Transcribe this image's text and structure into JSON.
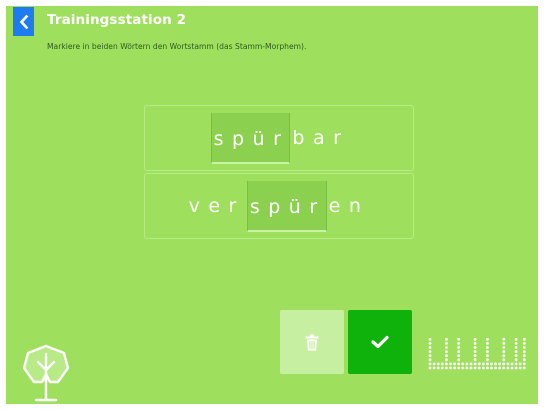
{
  "header": {
    "title": "Trainingsstation 2",
    "back_icon": "chevron-left-icon"
  },
  "instruction": "Markiere in beiden Wörtern den Wortstamm (das Stamm-Morphem).",
  "words": [
    {
      "prefix": "",
      "stem": "spür",
      "suffix": "bar"
    },
    {
      "prefix": "ver",
      "stem": "spür",
      "suffix": "en"
    }
  ],
  "actions": {
    "delete_icon": "trash-icon",
    "confirm_icon": "checkmark-icon"
  },
  "colors": {
    "background": "#9ee05e",
    "back_button": "#1e7cf0",
    "confirm_button": "#0fb10b",
    "delete_button": "#c6efa1",
    "stem_highlight": "#8bd04f"
  }
}
